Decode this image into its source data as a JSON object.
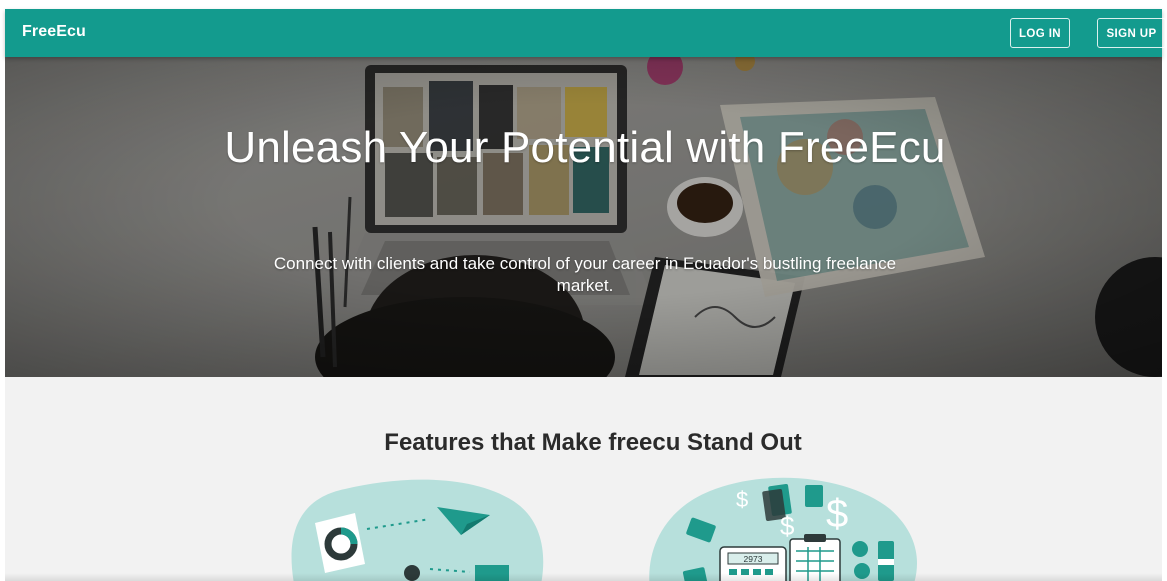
{
  "navbar": {
    "brand": "FreeEcu",
    "login_label": "LOG IN",
    "signup_label": "SIGN UP"
  },
  "hero": {
    "title": "Unleash Your Potential with FreeEcu",
    "subtitle": "Connect with clients and take control of your career in Ecuador's bustling freelance market.",
    "image_icon": "workspace-photo"
  },
  "features": {
    "title": "Features that Make freecu Stand Out",
    "illustrations": [
      {
        "icon": "networking-illustration"
      },
      {
        "icon": "payments-illustration",
        "calculator_display": "2973"
      }
    ]
  },
  "colors": {
    "primary": "#139b8e",
    "illustration_blob": "#b7e0dc",
    "illustration_dark": "#1f9a8c",
    "section_bg": "#f2f2f2"
  }
}
